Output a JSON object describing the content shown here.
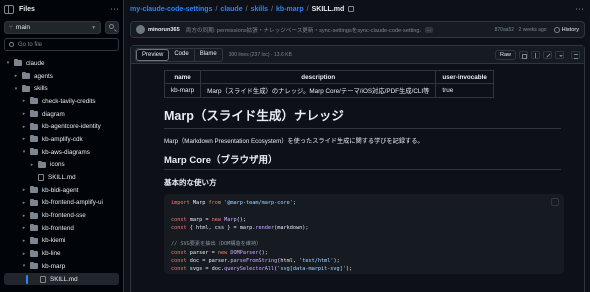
{
  "sidebar": {
    "title": "Files",
    "branch": "main",
    "goto_placeholder": "Go to file",
    "tree": [
      {
        "label": "claude",
        "indent": 0,
        "type": "folder",
        "open": true
      },
      {
        "label": "agents",
        "indent": 1,
        "type": "folder",
        "open": false
      },
      {
        "label": "skills",
        "indent": 1,
        "type": "folder",
        "open": true
      },
      {
        "label": "check-tavily-credits",
        "indent": 2,
        "type": "folder",
        "open": false
      },
      {
        "label": "diagram",
        "indent": 2,
        "type": "folder",
        "open": false
      },
      {
        "label": "kb-agentcore-identity",
        "indent": 2,
        "type": "folder",
        "open": false
      },
      {
        "label": "kb-amplify-cdk",
        "indent": 2,
        "type": "folder",
        "open": false
      },
      {
        "label": "kb-aws-diagrams",
        "indent": 2,
        "type": "folder",
        "open": true
      },
      {
        "label": "icons",
        "indent": 3,
        "type": "folder",
        "open": false
      },
      {
        "label": "SKILL.md",
        "indent": 3,
        "type": "file"
      },
      {
        "label": "kb-bidi-agent",
        "indent": 2,
        "type": "folder",
        "open": false
      },
      {
        "label": "kb-frontend-amplify-ui",
        "indent": 2,
        "type": "folder",
        "open": false
      },
      {
        "label": "kb-frontend-sse",
        "indent": 2,
        "type": "folder",
        "open": false
      },
      {
        "label": "kb-frontend",
        "indent": 2,
        "type": "folder",
        "open": false
      },
      {
        "label": "kb-kiemi",
        "indent": 2,
        "type": "folder",
        "open": false
      },
      {
        "label": "kb-line",
        "indent": 2,
        "type": "folder",
        "open": false
      },
      {
        "label": "kb-marp",
        "indent": 2,
        "type": "folder",
        "open": true
      },
      {
        "label": "SKILL.md",
        "indent": 3,
        "type": "file",
        "selected": true
      }
    ]
  },
  "breadcrumb": {
    "repo": "my-claude-code-settings",
    "parts": [
      "claude",
      "skills",
      "kb-marp"
    ],
    "current": "SKILL.md"
  },
  "commit": {
    "author": "minorun365",
    "message": "両方の同期: permissions拡張・ナレッジベース更新・sync-settingsをsync-claude-code-setting...",
    "ellipsis": "...",
    "hash_time": "870aa52 · 2 weeks ago",
    "history": "History"
  },
  "viewer": {
    "tabs": [
      "Preview",
      "Code",
      "Blame"
    ],
    "active_tab": "Preview",
    "lines_info": "300 lines (237 loc) · 13.6 KB",
    "raw": "Raw"
  },
  "doc": {
    "table": {
      "headers": [
        "name",
        "description",
        "user-invocable"
      ],
      "rows": [
        [
          "kb-marp",
          "Marp（スライド生成）のナレッジ。Marp Core/テーマ/iOS対応/PDF生成/CLI等",
          "true"
        ]
      ]
    },
    "h1": "Marp（スライド生成）ナレッジ",
    "intro": "Marp（Markdown Presentation Ecosystem）を使ったスライド生成に関する学びを記録する。",
    "h2": "Marp Core（ブラウザ用）",
    "h3": "基本的な使い方",
    "code": {
      "l1_kw": "import",
      "l1_a": " Marp ",
      "l1_kw2": "from",
      "l1_str": " '@marp-team/marp-core'",
      "l1_end": ";",
      "l2_kw": "const",
      "l2_a": " marp = ",
      "l2_kw2": "new",
      "l2_fn": " Marp",
      "l2_end": "();",
      "l3_kw": "const",
      "l3_a": " { html, css } = marp.",
      "l3_fn": "render",
      "l3_end": "(markdown);",
      "l4_cm": "// SVG要素を抽出（DOM構造を維持）",
      "l5_kw": "const",
      "l5_a": " parser = ",
      "l5_kw2": "new",
      "l5_fn": " DOMParser",
      "l5_end": "();",
      "l6_kw": "const",
      "l6_a": " doc = parser.",
      "l6_fn": "parseFromString",
      "l6_b": "(html, ",
      "l6_str": "'text/html'",
      "l6_end": ");",
      "l7_kw": "const",
      "l7_a": " svgs = doc.",
      "l7_fn": "querySelectorAll",
      "l7_b": "(",
      "l7_str": "'svg[data-marpit-svg]'",
      "l7_end": ");"
    }
  },
  "colors": {
    "accent": "#2f81f7",
    "bg": "#0d1117",
    "border": "#30363d"
  }
}
